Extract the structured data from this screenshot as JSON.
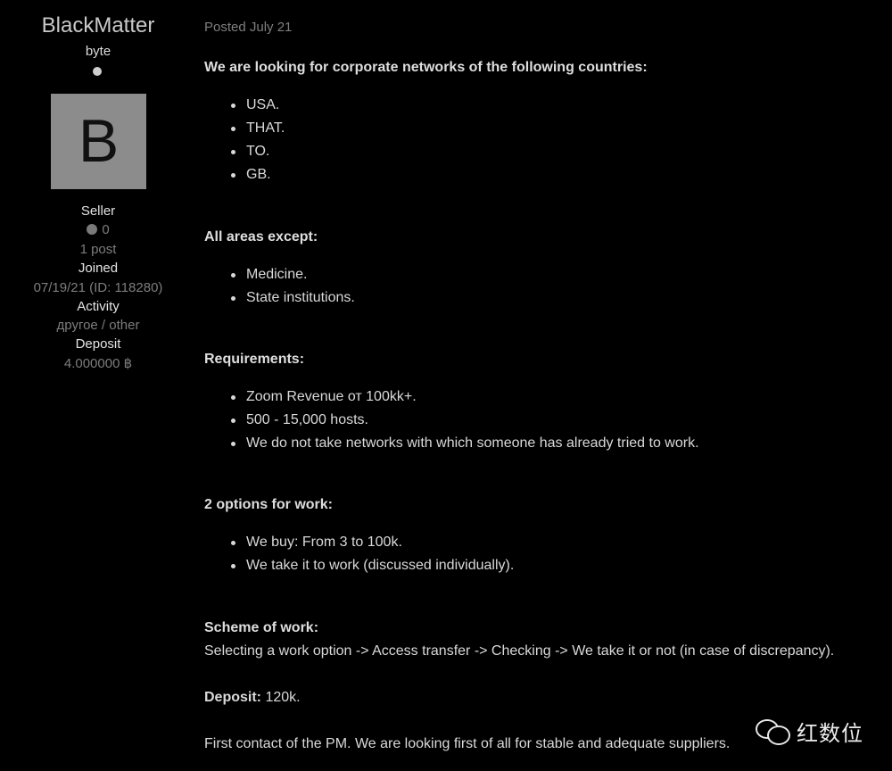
{
  "author": {
    "username": "BlackMatter",
    "rank": "byte",
    "avatar_letter": "B",
    "group": "Seller",
    "reputation": "0",
    "posts": "1 post",
    "joined_label": "Joined",
    "joined_value": "07/19/21 (ID: 118280)",
    "activity_label": "Activity",
    "activity_value": "другое / other",
    "deposit_label": "Deposit",
    "deposit_value": "4.000000 ฿"
  },
  "post": {
    "posted": "Posted July 21",
    "countries_heading": "We are looking for corporate networks of the following countries:",
    "countries": [
      "USA.",
      "THAT.",
      "TO.",
      "GB."
    ],
    "areas_heading": "All areas except:",
    "areas": [
      "Medicine.",
      "State institutions."
    ],
    "requirements_heading": "Requirements:",
    "requirements": [
      "Zoom Revenue от 100kk+.",
      "500 - 15,000 hosts.",
      "We do not take networks with which someone has already tried to work."
    ],
    "options_heading": "2 options for work:",
    "options": [
      "We buy: From 3 to 100k.",
      "We take it to work (discussed individually)."
    ],
    "scheme_heading": "Scheme of work:",
    "scheme_text": "Selecting a work option -> Access transfer -> Checking -> We take it or not (in case of discrepancy).",
    "deposit_label": "Deposit:",
    "deposit_text": " 120k.",
    "contact_text": "First contact of the PM. We are looking first of all for stable and adequate suppliers."
  },
  "watermark": {
    "text": "红数位",
    "icon": "wechat-icon"
  }
}
